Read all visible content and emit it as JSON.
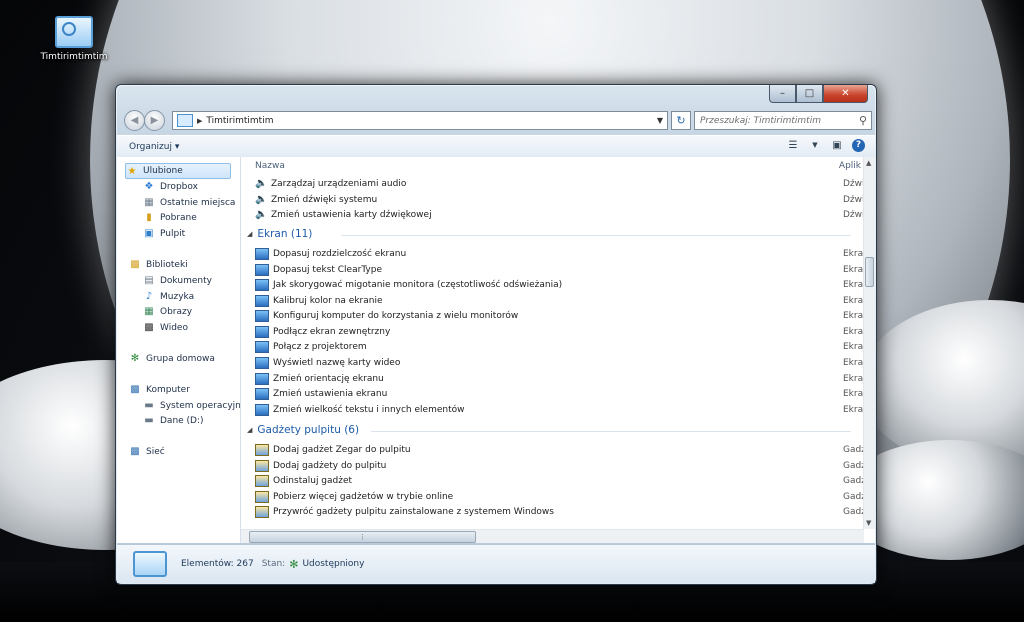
{
  "desktop": {
    "icon_label": "Timtirimtimtim"
  },
  "window": {
    "caption_buttons": {
      "minimize": "–",
      "maximize": "□",
      "close": "✕"
    },
    "address": {
      "path": "Timtirimtimtim"
    },
    "search": {
      "placeholder": "Przeszukaj: Timtirimtimtim"
    },
    "toolbar": {
      "organize_label": "Organizuj ▾"
    },
    "sidebar": {
      "favorites": {
        "label": "Ulubione",
        "items": [
          "Dropbox",
          "Ostatnie miejsca",
          "Pobrane",
          "Pulpit"
        ]
      },
      "libraries": {
        "label": "Biblioteki",
        "items": [
          "Dokumenty",
          "Muzyka",
          "Obrazy",
          "Wideo"
        ]
      },
      "homegroup": "Grupa domowa",
      "computer": {
        "label": "Komputer",
        "items": [
          "System operacyjny (",
          "Dane (D:)"
        ]
      },
      "network": "Sieć"
    },
    "columns": {
      "name": "Nazwa",
      "app": "Aplik"
    },
    "audio_rows": [
      {
        "name": "Zarządzaj urządzeniami audio",
        "cat": "Dźwi"
      },
      {
        "name": "Zmień dźwięki systemu",
        "cat": "Dźwi"
      },
      {
        "name": "Zmień ustawienia karty dźwiękowej",
        "cat": "Dźwi"
      }
    ],
    "groups": {
      "ekran": {
        "title": "Ekran (11)",
        "rows": [
          {
            "name": "Dopasuj rozdzielczość ekranu",
            "cat": "Ekran"
          },
          {
            "name": "Dopasuj tekst ClearType",
            "cat": "Ekran"
          },
          {
            "name": "Jak skorygować migotanie monitora (częstotliwość odświeżania)",
            "cat": "Ekran"
          },
          {
            "name": "Kalibruj kolor na ekranie",
            "cat": "Ekran"
          },
          {
            "name": "Konfiguruj komputer do korzystania z wielu monitorów",
            "cat": "Ekran"
          },
          {
            "name": "Podłącz ekran zewnętrzny",
            "cat": "Ekran"
          },
          {
            "name": "Połącz z projektorem",
            "cat": "Ekran"
          },
          {
            "name": "Wyświetl nazwę karty wideo",
            "cat": "Ekran"
          },
          {
            "name": "Zmień orientację ekranu",
            "cat": "Ekran"
          },
          {
            "name": "Zmień ustawienia ekranu",
            "cat": "Ekran"
          },
          {
            "name": "Zmień wielkość tekstu i innych elementów",
            "cat": "Ekran"
          }
        ]
      },
      "gadzety": {
        "title": "Gadżety pulpitu (6)",
        "rows": [
          {
            "name": "Dodaj gadżet Zegar do pulpitu",
            "cat": "Gadź"
          },
          {
            "name": "Dodaj gadżety do pulpitu",
            "cat": "Gadź"
          },
          {
            "name": "Odinstaluj gadżet",
            "cat": "Gadź"
          },
          {
            "name": "Pobierz więcej gadżetów w trybie online",
            "cat": "Gadź"
          },
          {
            "name": "Przywróć gadżety pulpitu zainstalowane z systemem Windows",
            "cat": "Gadź"
          }
        ]
      }
    },
    "details": {
      "count": "Elementów: 267",
      "state_label": "Stan:",
      "state_value": "Udostępniony"
    }
  }
}
